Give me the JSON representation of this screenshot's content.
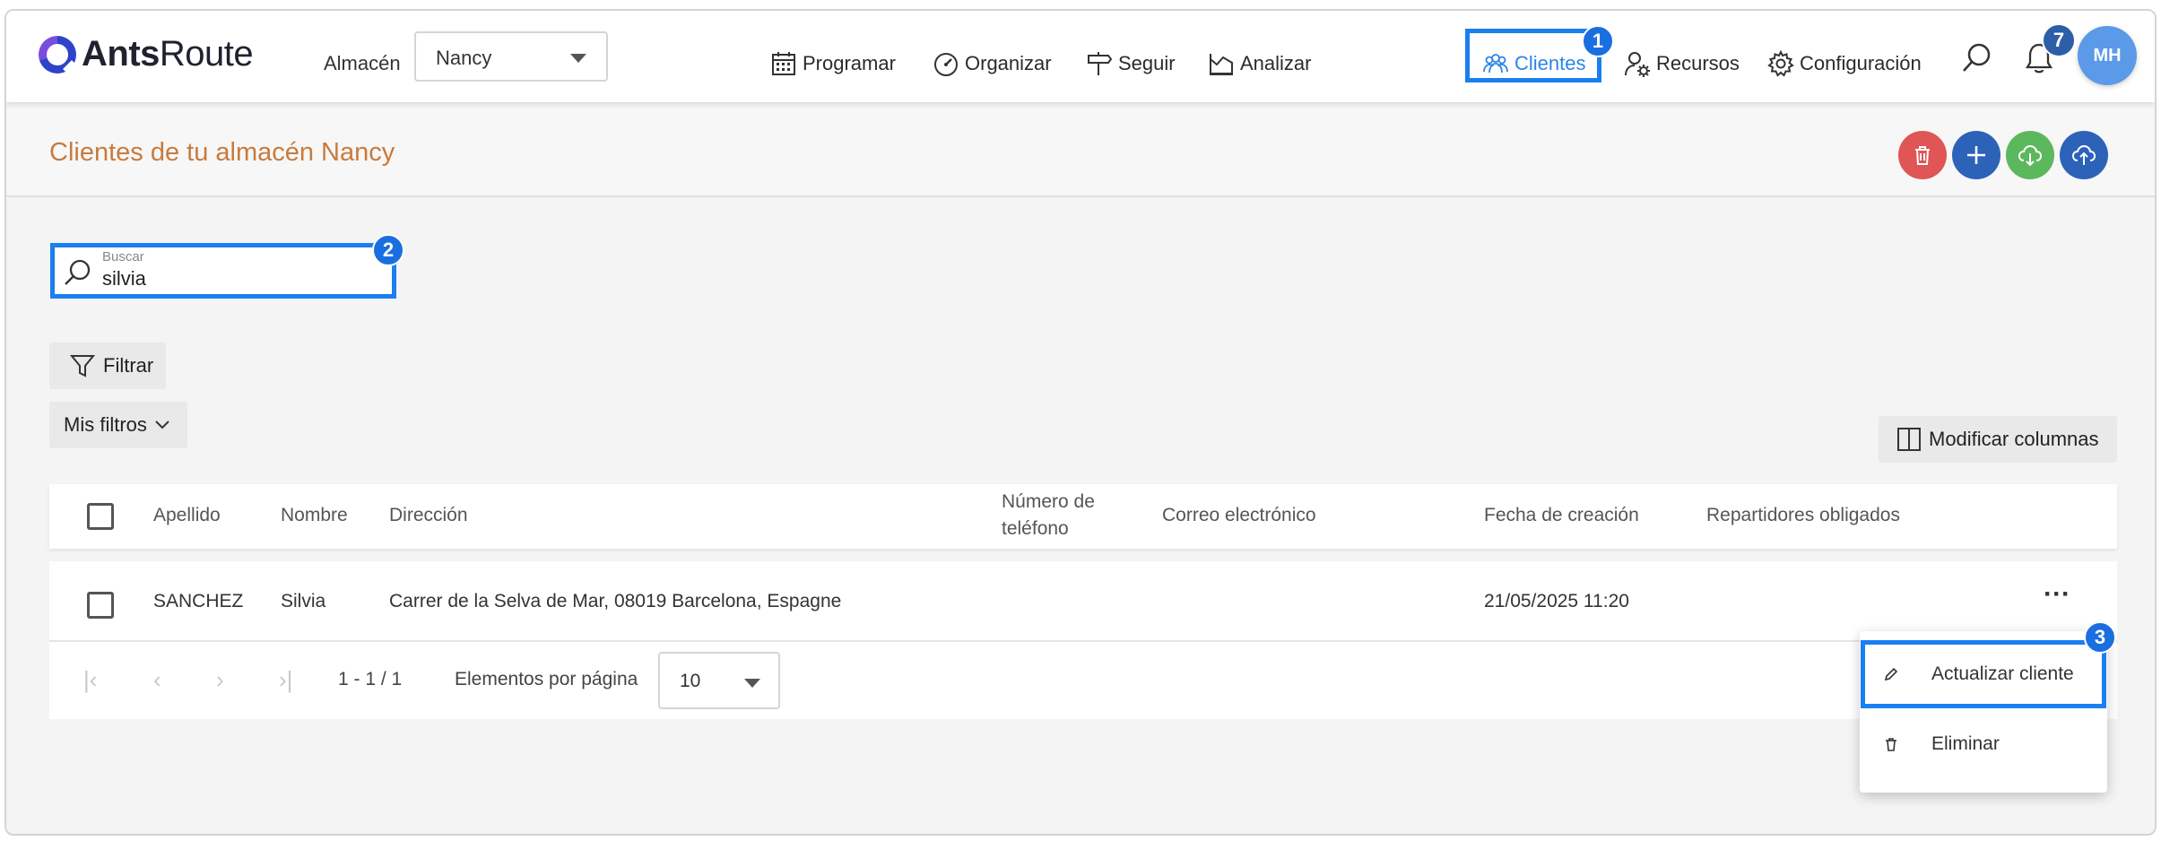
{
  "brand": {
    "bold": "Ants",
    "light": "Route"
  },
  "warehouse": {
    "label": "Almacén",
    "value": "Nancy"
  },
  "nav": {
    "programar": "Programar",
    "organizar": "Organizar",
    "seguir": "Seguir",
    "analizar": "Analizar",
    "clientes": "Clientes",
    "recursos": "Recursos",
    "configuracion": "Configuración"
  },
  "notifications": {
    "count": "7"
  },
  "user": {
    "initials": "MH"
  },
  "steps": {
    "one": "1",
    "two": "2",
    "three": "3"
  },
  "page": {
    "title": "Clientes de tu almacén Nancy"
  },
  "search": {
    "label": "Buscar",
    "value": "silvia"
  },
  "filters": {
    "filter_label": "Filtrar",
    "my_filters_label": "Mis filtros",
    "modify_columns_label": "Modificar columnas"
  },
  "table": {
    "headers": {
      "apellido": "Apellido",
      "nombre": "Nombre",
      "direccion": "Dirección",
      "telefono_1": "Número de",
      "telefono_2": "teléfono",
      "correo": "Correo electrónico",
      "fecha": "Fecha de creación",
      "repartidores": "Repartidores obligados"
    },
    "rows": [
      {
        "apellido": "SANCHEZ",
        "nombre": "Silvia",
        "direccion": "Carrer de la Selva de Mar, 08019 Barcelona, Espagne",
        "telefono": "",
        "correo": "",
        "fecha": "21/05/2025 11:20",
        "repartidores": "",
        "more": "···"
      }
    ]
  },
  "pagination": {
    "range": "1 - 1 / 1",
    "per_page_label": "Elementos por página",
    "per_page_value": "10"
  },
  "row_menu": {
    "update": "Actualizar cliente",
    "delete": "Eliminar"
  },
  "colors": {
    "accent": "#1a7ff0",
    "title": "#c87b3c",
    "delete": "#e05555",
    "add": "#2c63b8",
    "upload": "#5cb85c"
  }
}
